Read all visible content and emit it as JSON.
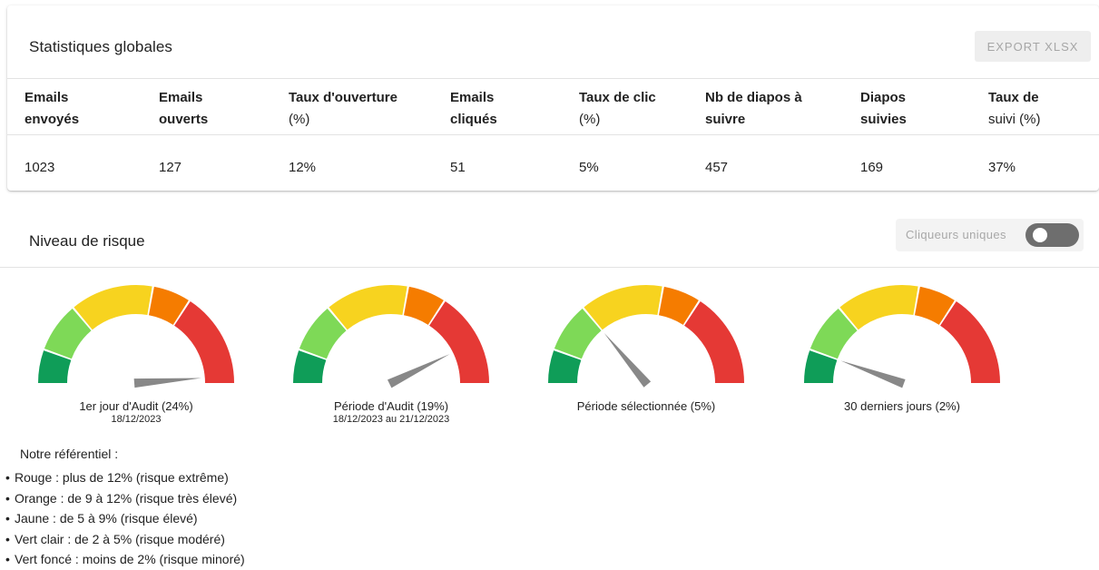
{
  "stats": {
    "title": "Statistiques globales",
    "export_label": "EXPORT XLSX",
    "columns": [
      {
        "l1": "Emails",
        "l2": "envoyés",
        "value": "1023"
      },
      {
        "l1": "Emails",
        "l2": "ouverts",
        "value": "127"
      },
      {
        "l1": "Taux d'ouverture",
        "l2": "(%)",
        "value": "12%"
      },
      {
        "l1": "Emails",
        "l2": "cliqués",
        "value": "51"
      },
      {
        "l1": "Taux de clic",
        "l2": "(%)",
        "value": "5%"
      },
      {
        "l1": "Nb de diapos à",
        "l2": "suivre",
        "value": "457"
      },
      {
        "l1": "Diapos",
        "l2": "suivies",
        "value": "169"
      },
      {
        "l1": "Taux de",
        "l2": "suivi (%)",
        "value": "37%"
      }
    ]
  },
  "risk": {
    "title": "Niveau de risque",
    "toggle_label": "Cliqueurs uniques",
    "toggle_on": false,
    "colors": [
      "#0f9d58",
      "#7ed957",
      "#f7d31f",
      "#f57c00",
      "#e53935"
    ],
    "needle_color": "#888888",
    "gauges": [
      {
        "label": "1er jour d'Audit (24%)",
        "sub": "18/12/2023",
        "percent": 24
      },
      {
        "label": "Période d'Audit (19%)",
        "sub": "18/12/2023 au 21/12/2023",
        "percent": 19
      },
      {
        "label": "Période sélectionnée (5%)",
        "sub": "",
        "percent": 5
      },
      {
        "label": "30 derniers jours (2%)",
        "sub": "",
        "percent": 2
      }
    ]
  },
  "referentiel": {
    "title": "Notre référentiel :",
    "items": [
      {
        "name": "Rouge",
        "text": " : plus de 12% (risque extrême)"
      },
      {
        "name": "Orange",
        "text": " : de 9 à 12% (risque très élevé)"
      },
      {
        "name": "Jaune",
        "text": " : de 5 à 9% (risque élevé)"
      },
      {
        "name": "Vert clair",
        "text": " : de 2 à 5% (risque modéré)"
      },
      {
        "name": "Vert foncé",
        "text": " : moins de 2% (risque minoré)"
      }
    ]
  }
}
